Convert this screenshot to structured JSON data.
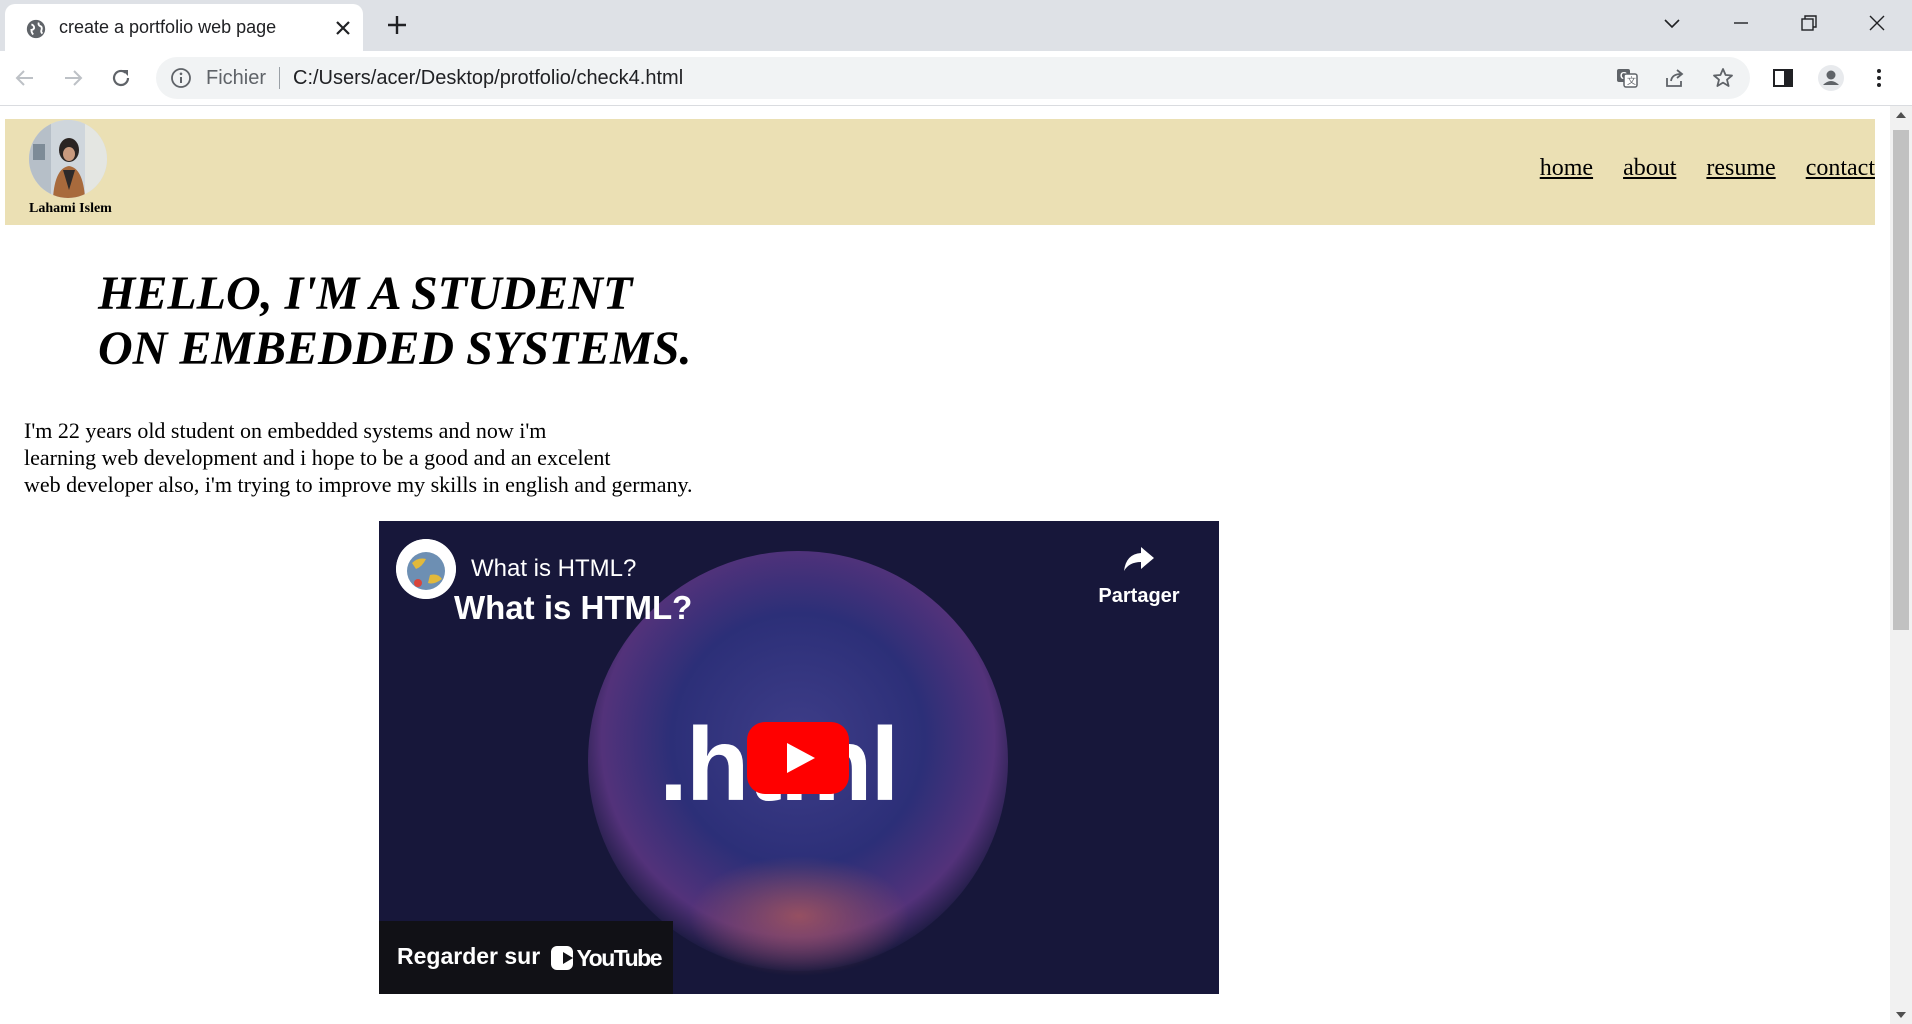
{
  "browser": {
    "tab": {
      "title": "create a portfolio web page",
      "favicon_icon": "globe-icon",
      "close_icon": "close-icon"
    },
    "new_tab_icon": "plus-icon",
    "window_controls": [
      "chevron-down-icon",
      "minimize-icon",
      "restore-icon",
      "close-icon"
    ],
    "address_bar": {
      "security_label": "Fichier",
      "url": "C:/Users/acer/Desktop/protfolio/check4.html"
    },
    "toolbar_icons": [
      "translate-icon",
      "share-icon",
      "bookmark-star-icon",
      "side-panel-icon",
      "profile-icon",
      "more-menu-icon"
    ]
  },
  "page": {
    "header": {
      "name": "Lahami Islem",
      "nav": [
        "home",
        "about",
        "resume",
        "contact"
      ],
      "background": "#ebe0b4"
    },
    "hero": {
      "title_line1": "HELLO, I'M A STUDENT",
      "title_line2": "ON EMBEDDED SYSTEMS."
    },
    "intro": {
      "line1": "I'm 22 years old student on embedded systems and now i'm",
      "line2": "learning web development and i hope to be a good and an excelent",
      "line3": "web developer also, i'm trying to improve my skills in english and germany."
    },
    "video": {
      "title": "What is HTML?",
      "subtitle": "What is HTML?",
      "share_label": "Partager",
      "logo_text": ".html",
      "watch_label": "Regarder sur",
      "brand": "YouTube",
      "play_color": "#ff0000"
    }
  }
}
